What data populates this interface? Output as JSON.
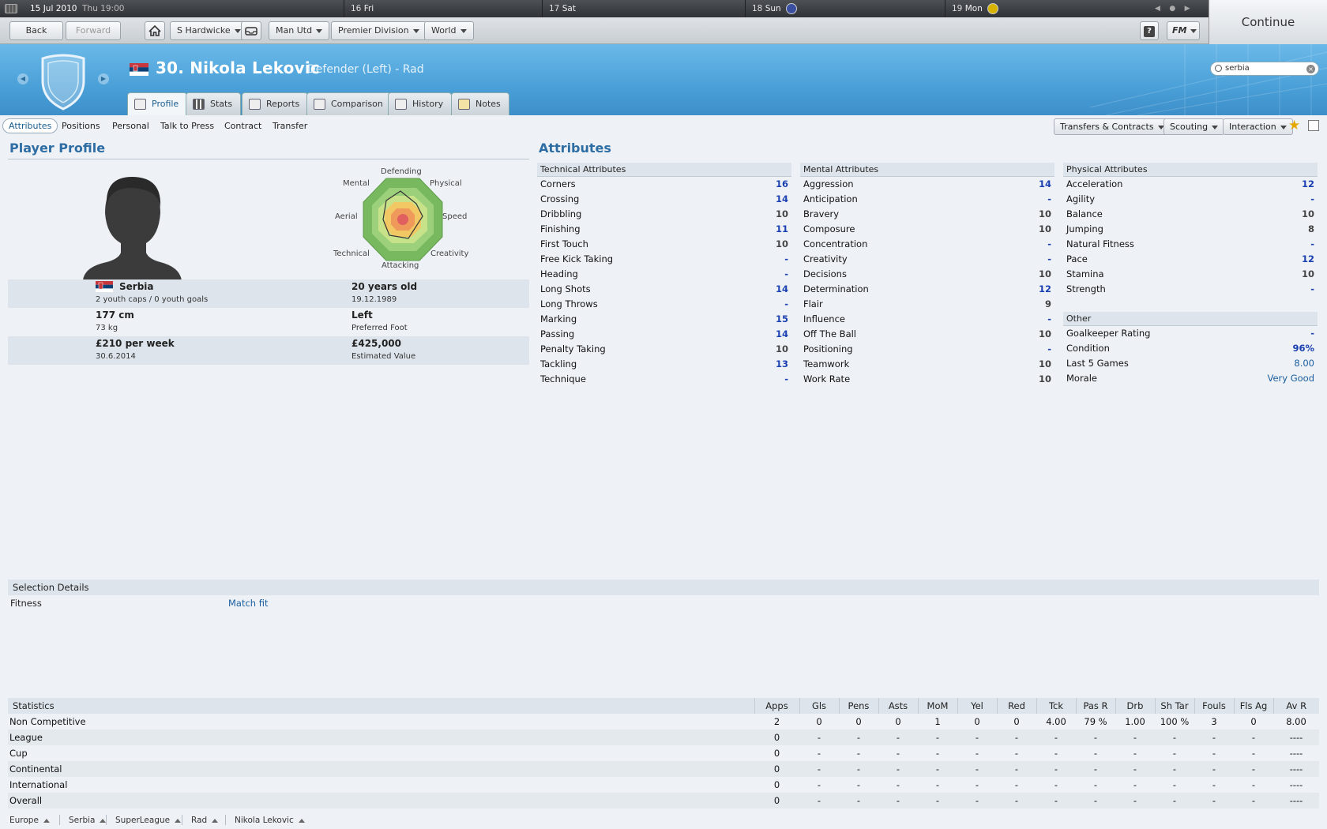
{
  "topbar": {
    "date": "15 Jul 2010",
    "time": "Thu 19:00",
    "days": [
      {
        "num": "16",
        "day": "Fri"
      },
      {
        "num": "17",
        "day": "Sat"
      },
      {
        "num": "18",
        "day": "Sun"
      },
      {
        "num": "19",
        "day": "Mon"
      }
    ],
    "continue_label": "Continue"
  },
  "toolbar": {
    "back": "Back",
    "forward": "Forward",
    "manager": "S Hardwicke",
    "club": "Man Utd",
    "league": "Premier Division",
    "world": "World",
    "fm_label": "FM",
    "help_label": "?"
  },
  "header": {
    "title": "30. Nikola Lekovic",
    "subtitle": "Defender (Left) - Rad",
    "search_value": "serbia"
  },
  "tabs": [
    "Profile",
    "Stats",
    "Reports",
    "Comparison",
    "History",
    "Notes"
  ],
  "subnav": [
    "Attributes",
    "Positions",
    "Personal",
    "Talk to Press",
    "Contract",
    "Transfer"
  ],
  "dropdowns": [
    "Transfers & Contracts",
    "Scouting",
    "Interaction"
  ],
  "profile": {
    "title": "Player Profile",
    "radar_labels": {
      "defending": "Defending",
      "physical": "Physical",
      "speed": "Speed",
      "creativity": "Creativity",
      "attacking": "Attacking",
      "technical": "Technical",
      "aerial": "Aerial",
      "mental": "Mental"
    },
    "nationality": "Serbia",
    "caps": "2 youth caps / 0 youth goals",
    "age": "20 years old",
    "dob": "19.12.1989",
    "height": "177 cm",
    "weight": "73 kg",
    "foot": "Left",
    "foot_label": "Preferred Foot",
    "wage": "£210 per week",
    "contract_end": "30.6.2014",
    "value": "£425,000",
    "value_label": "Estimated Value"
  },
  "attributes": {
    "title": "Attributes",
    "technical": {
      "heading": "Technical Attributes",
      "rows": [
        {
          "name": "Corners",
          "value": "16"
        },
        {
          "name": "Crossing",
          "value": "14"
        },
        {
          "name": "Dribbling",
          "value": "10"
        },
        {
          "name": "Finishing",
          "value": "11"
        },
        {
          "name": "First Touch",
          "value": "10"
        },
        {
          "name": "Free Kick Taking",
          "value": "-"
        },
        {
          "name": "Heading",
          "value": "-"
        },
        {
          "name": "Long Shots",
          "value": "14"
        },
        {
          "name": "Long Throws",
          "value": "-"
        },
        {
          "name": "Marking",
          "value": "15"
        },
        {
          "name": "Passing",
          "value": "14"
        },
        {
          "name": "Penalty Taking",
          "value": "10"
        },
        {
          "name": "Tackling",
          "value": "13"
        },
        {
          "name": "Technique",
          "value": "-"
        }
      ]
    },
    "mental": {
      "heading": "Mental Attributes",
      "rows": [
        {
          "name": "Aggression",
          "value": "14"
        },
        {
          "name": "Anticipation",
          "value": "-"
        },
        {
          "name": "Bravery",
          "value": "10"
        },
        {
          "name": "Composure",
          "value": "10"
        },
        {
          "name": "Concentration",
          "value": "-"
        },
        {
          "name": "Creativity",
          "value": "-"
        },
        {
          "name": "Decisions",
          "value": "10"
        },
        {
          "name": "Determination",
          "value": "12"
        },
        {
          "name": "Flair",
          "value": "9"
        },
        {
          "name": "Influence",
          "value": "-"
        },
        {
          "name": "Off The Ball",
          "value": "10"
        },
        {
          "name": "Positioning",
          "value": "-"
        },
        {
          "name": "Teamwork",
          "value": "10"
        },
        {
          "name": "Work Rate",
          "value": "10"
        }
      ]
    },
    "physical": {
      "heading": "Physical Attributes",
      "rows": [
        {
          "name": "Acceleration",
          "value": "12"
        },
        {
          "name": "Agility",
          "value": "-"
        },
        {
          "name": "Balance",
          "value": "10"
        },
        {
          "name": "Jumping",
          "value": "8"
        },
        {
          "name": "Natural Fitness",
          "value": "-"
        },
        {
          "name": "Pace",
          "value": "12"
        },
        {
          "name": "Stamina",
          "value": "10"
        },
        {
          "name": "Strength",
          "value": "-"
        }
      ]
    },
    "other": {
      "heading": "Other",
      "rows": [
        {
          "name": "Goalkeeper Rating",
          "value": "-"
        },
        {
          "name": "Condition",
          "value": "96%"
        },
        {
          "name": "Last 5 Games",
          "value": "8.00"
        },
        {
          "name": "Morale",
          "value": "Very Good"
        }
      ]
    }
  },
  "selection": {
    "heading": "Selection Details",
    "fitness_label": "Fitness",
    "fitness_value": "Match fit"
  },
  "statistics": {
    "heading": "Statistics",
    "columns": [
      "Apps",
      "Gls",
      "Pens",
      "Asts",
      "MoM",
      "Yel",
      "Red",
      "Tck",
      "Pas R",
      "Drb",
      "Sh Tar",
      "Fouls",
      "Fls Ag",
      "Av R"
    ],
    "rows": [
      {
        "label": "Non Competitive",
        "cells": [
          "2",
          "0",
          "0",
          "0",
          "1",
          "0",
          "0",
          "4.00",
          "79 %",
          "1.00",
          "100 %",
          "3",
          "0",
          "8.00"
        ]
      },
      {
        "label": "League",
        "cells": [
          "0",
          "-",
          "-",
          "-",
          "-",
          "-",
          "-",
          "-",
          "-",
          "-",
          "-",
          "-",
          "-",
          "----"
        ]
      },
      {
        "label": "Cup",
        "cells": [
          "0",
          "-",
          "-",
          "-",
          "-",
          "-",
          "-",
          "-",
          "-",
          "-",
          "-",
          "-",
          "-",
          "----"
        ]
      },
      {
        "label": "Continental",
        "cells": [
          "0",
          "-",
          "-",
          "-",
          "-",
          "-",
          "-",
          "-",
          "-",
          "-",
          "-",
          "-",
          "-",
          "----"
        ]
      },
      {
        "label": "International",
        "cells": [
          "0",
          "-",
          "-",
          "-",
          "-",
          "-",
          "-",
          "-",
          "-",
          "-",
          "-",
          "-",
          "-",
          "----"
        ]
      },
      {
        "label": "Overall",
        "cells": [
          "0",
          "-",
          "-",
          "-",
          "-",
          "-",
          "-",
          "-",
          "-",
          "-",
          "-",
          "-",
          "-",
          "----"
        ]
      }
    ]
  },
  "breadcrumb": [
    "Europe",
    "Serbia",
    "SuperLeague",
    "Rad",
    "Nikola Lekovic"
  ],
  "colors": {
    "accent": "#2e6da4",
    "header": "#4aa0d8",
    "value_blue": "#1a3fb0"
  }
}
